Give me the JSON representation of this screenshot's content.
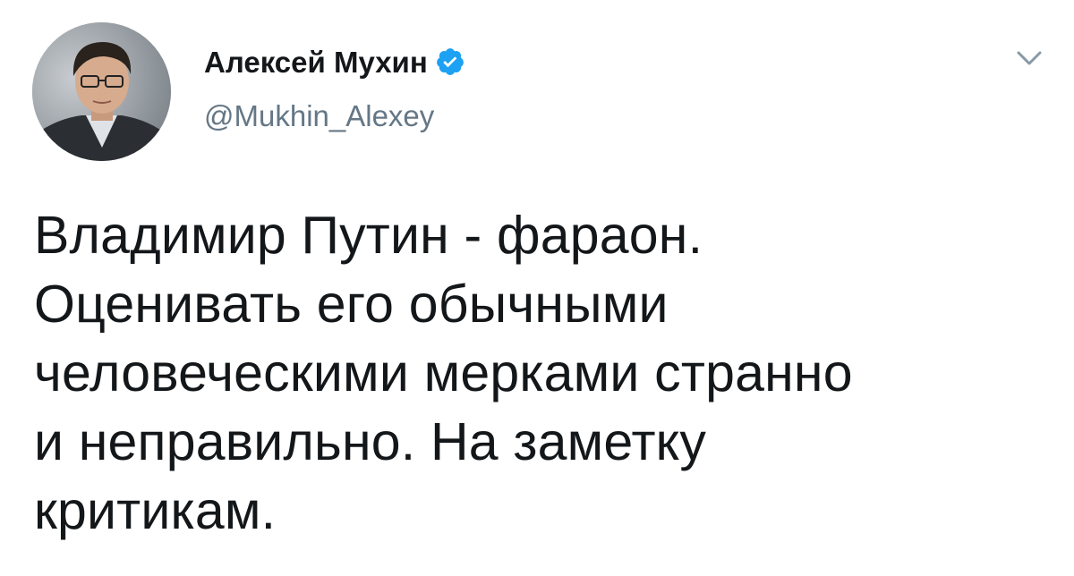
{
  "author": {
    "display_name": "Алексей Мухин",
    "handle": "@Mukhin_Alexey",
    "verified": true
  },
  "tweet": {
    "lines": [
      "Владимир Путин - фараон.",
      "Оценивать его обычными",
      "человеческими мерками странно",
      "и неправильно. На заметку",
      "критикам."
    ]
  },
  "icons": {
    "verified": "verified-badge-icon",
    "caret": "chevron-down-icon"
  },
  "colors": {
    "name": "#14171a",
    "handle": "#657786",
    "verified_badge": "#1da1f2",
    "caret": "#8899a6"
  }
}
